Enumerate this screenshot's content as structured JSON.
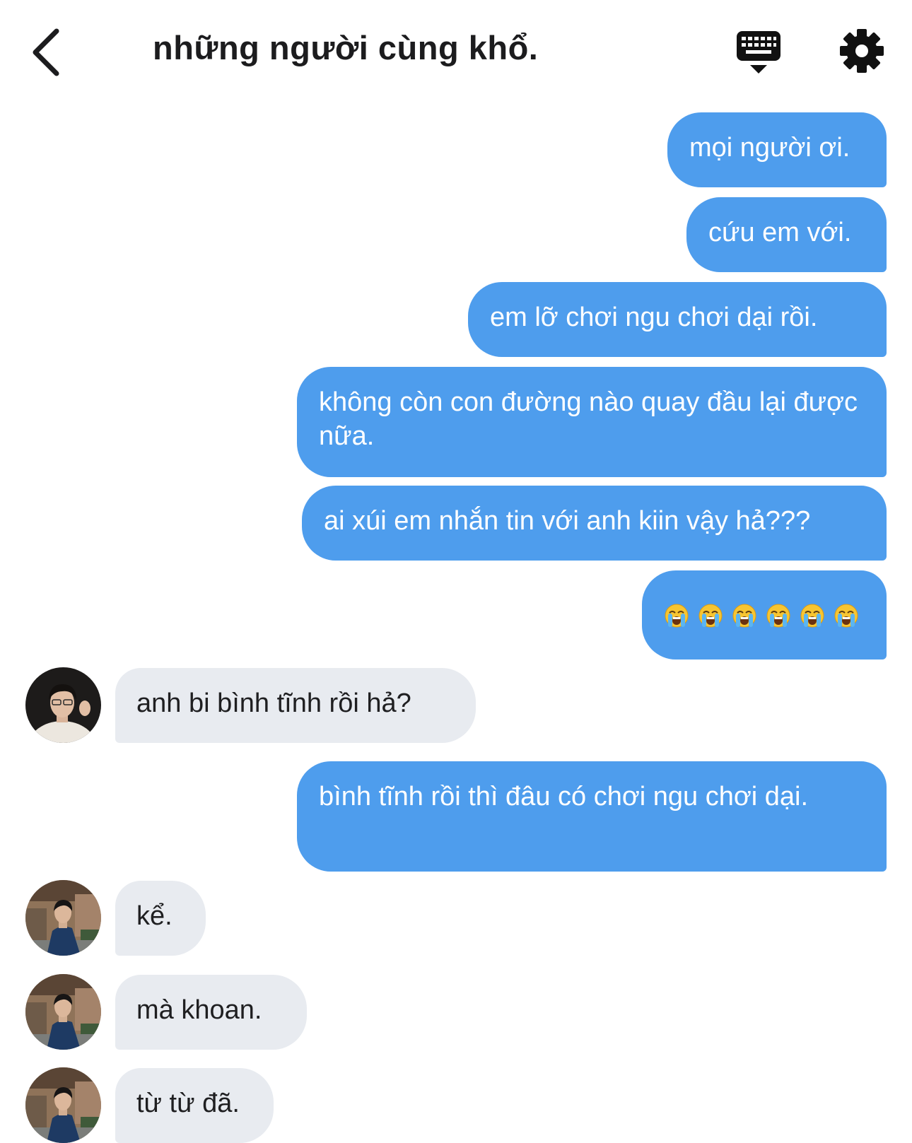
{
  "header": {
    "title": "những người cùng khổ.",
    "back_icon": "chevron-left-icon",
    "keyboard_icon": "keyboard-icon",
    "settings_icon": "gear-icon"
  },
  "colors": {
    "outgoing_bubble": "#4e9ded",
    "incoming_bubble": "#e8ebf0",
    "text_dark": "#1c1c1e",
    "text_light": "#ffffff"
  },
  "messages": [
    {
      "side": "out",
      "text": "mọi người ơi."
    },
    {
      "side": "out",
      "text": "cứu em với."
    },
    {
      "side": "out",
      "text": "em lỡ chơi ngu chơi dại rồi."
    },
    {
      "side": "out",
      "text": "không còn con đường nào quay đầu lại được nữa."
    },
    {
      "side": "out",
      "text": "ai xúi em nhắn tin với anh kiin vậy hả???"
    },
    {
      "side": "out",
      "text": "😭😭😭😭😭😭",
      "emoji": "loudly-crying-face-icon",
      "emoji_count": 6
    },
    {
      "side": "in",
      "text": "anh bi bình tĩnh rồi hả?",
      "avatar": "avatar-dark-portrait"
    },
    {
      "side": "out",
      "text": "bình tĩnh rồi thì đâu có chơi ngu chơi dại."
    },
    {
      "side": "in",
      "text": "kể.",
      "avatar": "avatar-street-portrait"
    },
    {
      "side": "in",
      "text": "mà khoan.",
      "avatar": "avatar-street-portrait"
    },
    {
      "side": "in",
      "text": "từ từ đã.",
      "avatar": "avatar-street-portrait"
    }
  ]
}
